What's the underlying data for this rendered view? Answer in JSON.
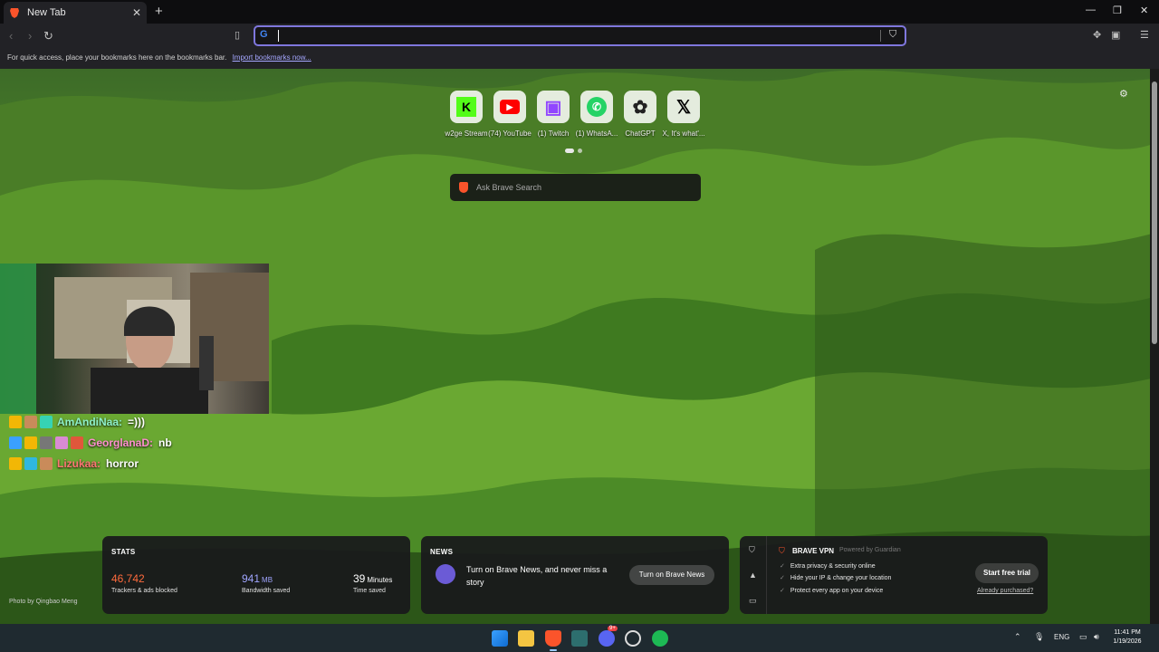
{
  "browser": {
    "tab_title": "New Tab",
    "address_value": "",
    "bookmarks_hint": "For quick access, place your bookmarks here on the bookmarks bar.",
    "import_link": "Import bookmarks now..."
  },
  "top_sites": [
    {
      "label": "w2ge Stream",
      "icon": "w2g-icon",
      "color": "#53fc18"
    },
    {
      "label": "(74) YouTube",
      "icon": "youtube-icon",
      "color": "#ff0000"
    },
    {
      "label": "(1) Twitch",
      "icon": "twitch-icon",
      "color": "#9146ff"
    },
    {
      "label": "(1) WhatsA...",
      "icon": "whatsapp-icon",
      "color": "#25d366"
    },
    {
      "label": "ChatGPT",
      "icon": "chatgpt-icon",
      "color": "#f0f0f0"
    },
    {
      "label": "X, It's what'...",
      "icon": "x-icon",
      "color": "#000000"
    }
  ],
  "search": {
    "placeholder": "Ask Brave Search"
  },
  "chat": [
    {
      "name": "AmAndiNaa:",
      "message": "=)))",
      "color": "#8ef0c9"
    },
    {
      "name": "GeorglanaD:",
      "message": "nb",
      "color": "#ff8fcf"
    },
    {
      "name": "Lizukaa:",
      "message": "horror",
      "color": "#ff7575"
    }
  ],
  "stats": {
    "title": "STATS",
    "trackers_value": "46,742",
    "trackers_label": "Trackers & ads blocked",
    "bandwidth_value": "941",
    "bandwidth_unit": "MB",
    "bandwidth_label": "Bandwidth saved",
    "time_value": "39",
    "time_unit": "Minutes",
    "time_label": "Time saved"
  },
  "news": {
    "title": "NEWS",
    "text": "Turn on Brave News, and never miss a story",
    "button": "Turn on Brave News"
  },
  "vpn": {
    "title": "BRAVE VPN",
    "powered": "Powered by Guardian",
    "features": [
      "Extra privacy & security online",
      "Hide your IP & change your location",
      "Protect every app on your device"
    ],
    "button": "Start free trial",
    "link": "Already purchased?"
  },
  "photo_credit": "Photo by Qingbao Meng",
  "taskbar": {
    "language": "ENG",
    "time": "11:41 PM",
    "date": "1/19/2026",
    "discord_badge": "9+"
  },
  "colors": {
    "accent": "#7f77dd",
    "brave_orange": "#fb542b",
    "stats_orange": "#ff6b3d",
    "stats_purple": "#a0a5ff"
  }
}
